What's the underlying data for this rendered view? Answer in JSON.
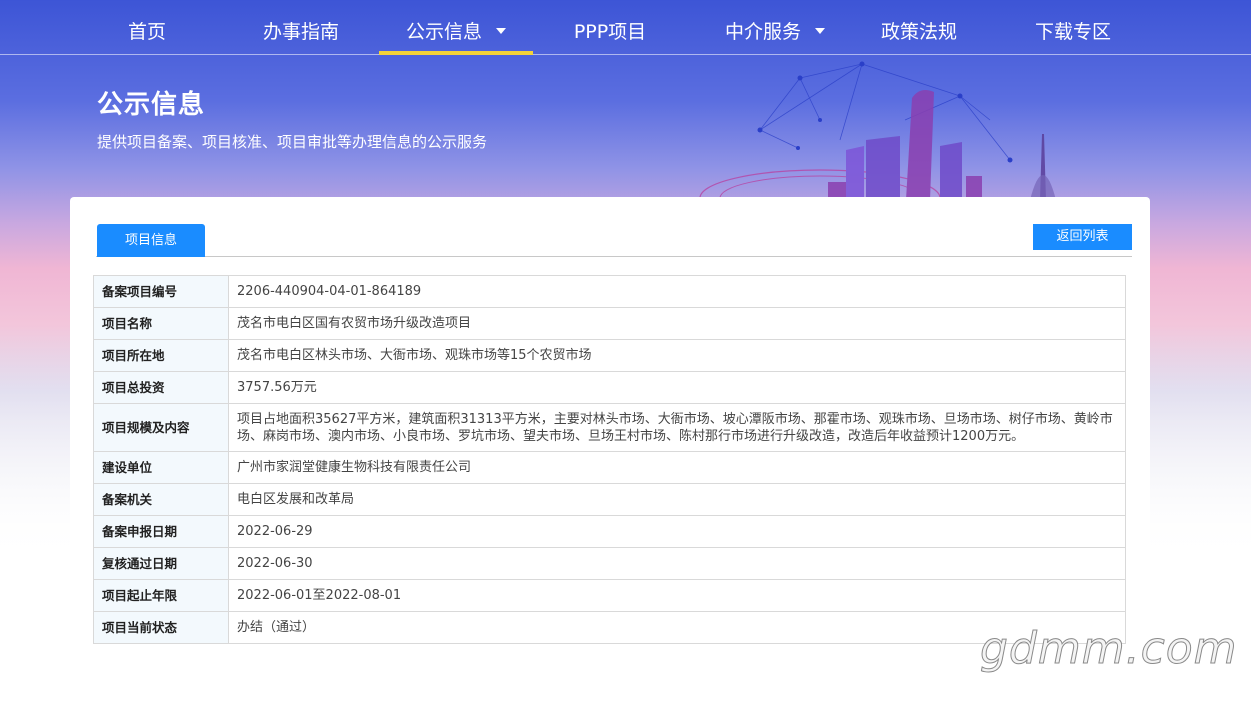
{
  "nav": {
    "items": [
      {
        "label": "首页"
      },
      {
        "label": "办事指南"
      },
      {
        "label": "公示信息",
        "active": true,
        "dropdown": true
      },
      {
        "label": "PPP项目"
      },
      {
        "label": "中介服务",
        "dropdown": true
      },
      {
        "label": "政策法规"
      },
      {
        "label": "下载专区"
      }
    ]
  },
  "hero": {
    "title": "公示信息",
    "subtitle": "提供项目备案、项目核准、项目审批等办理信息的公示服务"
  },
  "tabs": {
    "active_label": "项目信息",
    "back_label": "返回列表"
  },
  "project": {
    "rows": [
      {
        "label": "备案项目编号",
        "value": "2206-440904-04-01-864189"
      },
      {
        "label": "项目名称",
        "value": "茂名市电白区国有农贸市场升级改造项目"
      },
      {
        "label": "项目所在地",
        "value": "茂名市电白区林头市场、大衙市场、观珠市场等15个农贸市场"
      },
      {
        "label": "项目总投资",
        "value": "3757.56万元"
      },
      {
        "label": "项目规模及内容",
        "value": "项目占地面积35627平方米，建筑面积31313平方米，主要对林头市场、大衙市场、坡心潭阪市场、那霍市场、观珠市场、旦场市场、树仔市场、黄岭市场、麻岗市场、澳内市场、小良市场、罗坑市场、望夫市场、旦场王村市场、陈村那行市场进行升级改造，改造后年收益预计1200万元。"
      },
      {
        "label": "建设单位",
        "value": "广州市家润堂健康生物科技有限责任公司"
      },
      {
        "label": "备案机关",
        "value": "电白区发展和改革局"
      },
      {
        "label": "备案申报日期",
        "value": "2022-06-29"
      },
      {
        "label": "复核通过日期",
        "value": "2022-06-30"
      },
      {
        "label": "项目起止年限",
        "value": "2022-06-01至2022-08-01"
      },
      {
        "label": "项目当前状态",
        "value": "办结（通过）"
      }
    ]
  },
  "watermark": "gdmm.com",
  "colors": {
    "accent": "#1a8cff",
    "nav_underline": "#f2d23a",
    "label_bg": "#f3f9fd"
  }
}
